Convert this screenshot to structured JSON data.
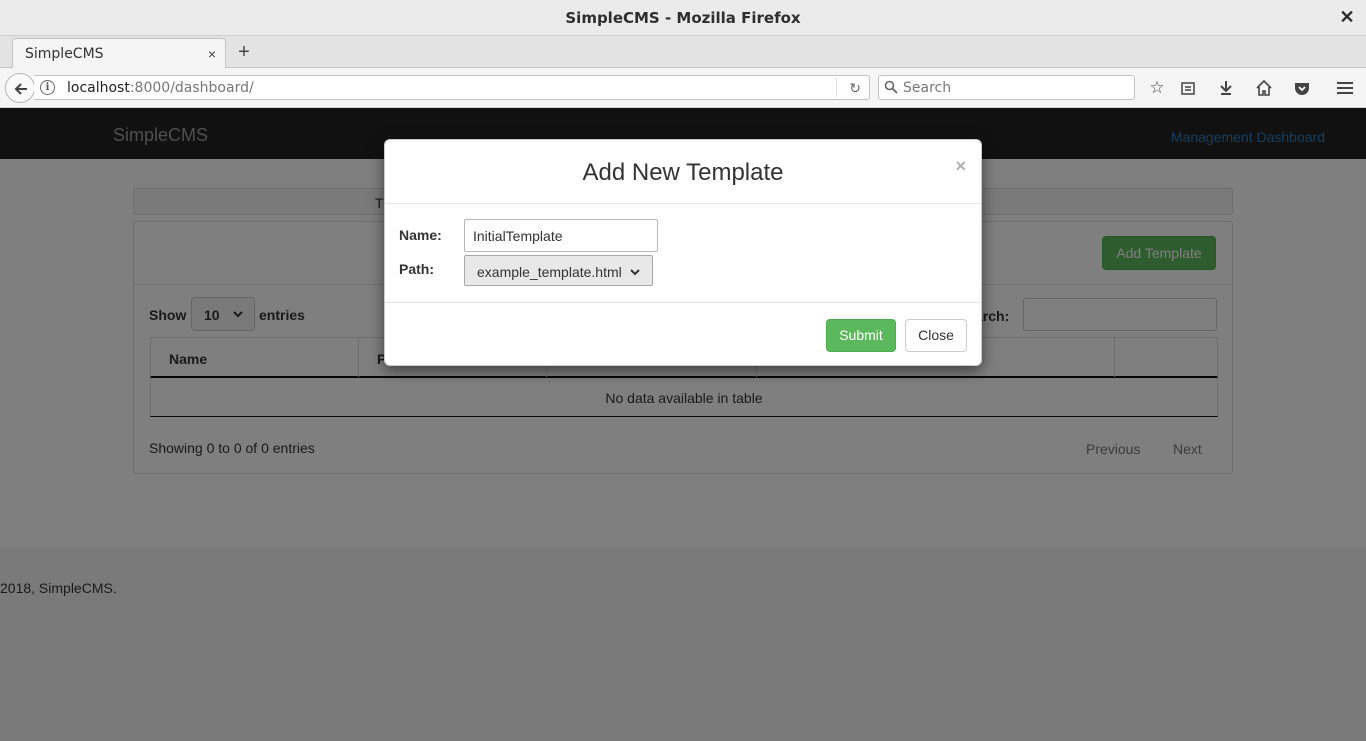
{
  "window": {
    "title": "SimpleCMS - Mozilla Firefox",
    "close_glyph": "✕"
  },
  "browser": {
    "tab_label": "SimpleCMS",
    "tab_close_glyph": "×",
    "new_tab_glyph": "+",
    "url_host": "localhost",
    "url_rest": ":8000/dashboard/",
    "search_placeholder": "Search",
    "info_glyph": "i",
    "reload_glyph": "↻",
    "toolbar_icons": [
      "bookmark-star-icon",
      "reading-list-icon",
      "download-icon",
      "home-icon",
      "pocket-icon",
      "menu-icon"
    ]
  },
  "app": {
    "brand": "SimpleCMS",
    "header_link": "Management Dashboard",
    "panel_heading_partial": "T",
    "add_template_label": "Add Template",
    "table": {
      "show_label": "Show",
      "page_size": "10",
      "entries_label": "entries",
      "search_label": "Search:",
      "search_label_visible": "arch:",
      "columns": [
        "Name",
        "P",
        "",
        "",
        ""
      ],
      "empty_message": "No data available in table",
      "info": "Showing 0 to 0 of 0 entries",
      "previous": "Previous",
      "next": "Next"
    },
    "footer": "2018, SimpleCMS."
  },
  "modal": {
    "title": "Add New Template",
    "close_glyph": "×",
    "name_label": "Name:",
    "name_value": "InitialTemplate",
    "path_label": "Path:",
    "path_value": "example_template.html",
    "submit_label": "Submit",
    "close_label": "Close"
  },
  "colors": {
    "primary_green": "#5cb85c",
    "link_blue": "#337ab7",
    "navbar_dark": "#222222",
    "backdrop": "rgba(0,0,0,0.5)"
  }
}
